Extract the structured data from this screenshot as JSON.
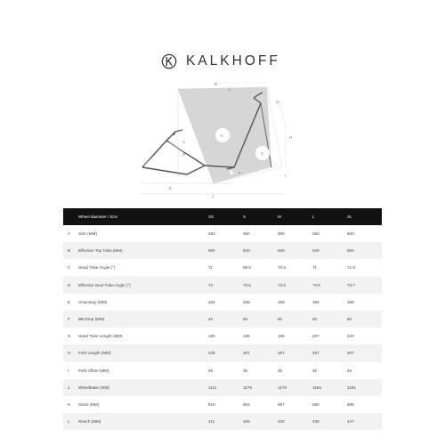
{
  "brand": {
    "name": "KALKHOFF",
    "logo_icon": "kalkhoff-k-logo"
  },
  "diagram": {
    "labels": [
      "A",
      "B",
      "C",
      "D",
      "E",
      "F",
      "G",
      "H",
      "I",
      "J",
      "K",
      "L"
    ]
  },
  "table": {
    "header_key": "",
    "header_title": "Wheel diameter / Size",
    "sizes": [
      "XS",
      "S",
      "M",
      "L",
      "XL"
    ],
    "rows": [
      {
        "key": "A",
        "name": "Size (MM)",
        "values": [
          "450",
          "450",
          "500",
          "550",
          "600"
        ]
      },
      {
        "key": "B",
        "name": "Effective Top Tube (MM)",
        "values": [
          "600",
          "620",
          "630",
          "640",
          "650"
        ]
      },
      {
        "key": "C",
        "name": "Head Tube Angle (°)",
        "values": [
          "71",
          "69.5",
          "70.5",
          "71",
          "71.5"
        ]
      },
      {
        "key": "D",
        "name": "Effective Seat Tube Angle (°)",
        "values": [
          "73",
          "73.5",
          "73.5",
          "73.5",
          "73.7"
        ]
      },
      {
        "key": "E",
        "name": "Chainstay (MM)",
        "values": [
          "455",
          "488",
          "488",
          "488",
          "488"
        ]
      },
      {
        "key": "F",
        "name": "BB Drop (MM)",
        "values": [
          "40",
          "60",
          "60",
          "60",
          "60"
        ]
      },
      {
        "key": "G",
        "name": "Head Tube Length (MM)",
        "values": [
          "185",
          "185",
          "195",
          "207",
          "220"
        ]
      },
      {
        "key": "H",
        "name": "Fork Length (MM)",
        "values": [
          "445",
          "467",
          "467",
          "467",
          "467"
        ]
      },
      {
        "key": "I",
        "name": "Fork Offset (MM)",
        "values": [
          "45",
          "45",
          "45",
          "45",
          "45"
        ]
      },
      {
        "key": "J",
        "name": "Wheelbase (MM)",
        "values": [
          "1111",
          "1179",
          "1179",
          "1184",
          "1191"
        ]
      },
      {
        "key": "K",
        "name": "Stack (MM)",
        "values": [
          "619",
          "653",
          "667",
          "680",
          "695"
        ]
      },
      {
        "key": "L",
        "name": "Reach (MM)",
        "values": [
          "411",
          "425",
          "432",
          "438",
          "447"
        ]
      }
    ]
  }
}
